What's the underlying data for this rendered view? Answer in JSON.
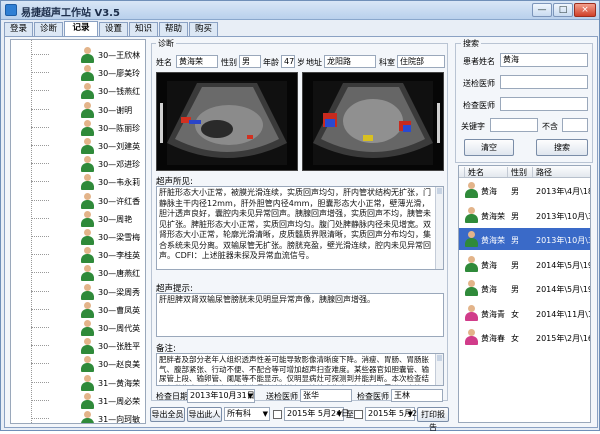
{
  "window": {
    "title": "易捷超声工作站 V3.5",
    "min": "—",
    "max": "□",
    "close": "×"
  },
  "tabs": [
    "登录",
    "诊断",
    "记录",
    "设置",
    "知识",
    "帮助",
    "购买"
  ],
  "patients": [
    {
      "label": "30—王欣林",
      "color": "#2f8a3a"
    },
    {
      "label": "30—廖美玲",
      "color": "#2f8a3a"
    },
    {
      "label": "30—钱燕红",
      "color": "#2f8a3a"
    },
    {
      "label": "30—谢明",
      "color": "#2f8a3a"
    },
    {
      "label": "30—陈丽珍",
      "color": "#2f8a3a"
    },
    {
      "label": "30—刘建英",
      "color": "#2f8a3a"
    },
    {
      "label": "30—邓进珍",
      "color": "#2f8a3a"
    },
    {
      "label": "30—韦永莉",
      "color": "#2f8a3a"
    },
    {
      "label": "30—许红香",
      "color": "#2f8a3a"
    },
    {
      "label": "30—周艳",
      "color": "#2f8a3a"
    },
    {
      "label": "30—梁雪梅",
      "color": "#2f8a3a"
    },
    {
      "label": "30—李桂英",
      "color": "#2f8a3a"
    },
    {
      "label": "30—唐燕红",
      "color": "#2f8a3a"
    },
    {
      "label": "30—梁周秀",
      "color": "#2f8a3a"
    },
    {
      "label": "30—曹凤英",
      "color": "#2f8a3a"
    },
    {
      "label": "30—周代英",
      "color": "#2f8a3a"
    },
    {
      "label": "30—张胜平",
      "color": "#2f8a3a"
    },
    {
      "label": "30—赵良美",
      "color": "#2f8a3a"
    },
    {
      "label": "31—黄海荣",
      "color": "#2f8a3a"
    },
    {
      "label": "31—周必荣",
      "color": "#2f8a3a"
    },
    {
      "label": "31—向珂敏",
      "color": "#2f8a3a"
    }
  ],
  "diagnosis": {
    "legend": "诊断",
    "name_label": "姓名",
    "name": "黄海荣",
    "sex_label": "性别",
    "sex": "男",
    "age_label": "年龄",
    "age": "47",
    "age_unit": "岁",
    "address_label": "地址",
    "address": "龙阳路",
    "dept_label": "科室",
    "dept": "住院部",
    "findings_label": "超声所见:",
    "findings": "肝脏形态大小正常，被膜光滑连续，实质回声均匀，肝内管状结构无扩张，门静脉主干内径12mm，肝外胆管内径4mm，胆囊形态大小正常，壁薄光滑，胆汁透声良好，囊腔内未见异常回声。胰腺回声增强，实质回声不均，胰管未见扩张。脾脏形态大小正常，实质回声均匀。腹门处脾静脉内径未见增宽。双肾形态大小正常，轮廓光滑清晰，皮质髓质界限清晰，实质回声分布均匀，集合系统未见分离。双输尿管无扩张。膀胱充盈，壁光滑连续，腔内未见异常回声。CDFI：上述脏器未探及异常血流信号。",
    "impression_label": "超声提示:",
    "impression": "肝胆脾双肾双输尿管膀胱未见明显异常声像，胰腺回声增强。",
    "remarks_label": "备注:",
    "remarks": "肥胖者及部分老年人组织透声性差可能导致影像清晰度下降。消瘦、胃肠、胃肠胀气、腹部紧张、行动不便、不配合等可增加超声扫查难度。某些器官如胆囊管、输尿管上段、输卵管、阑尾等不能显示。仅明显病灶可探测到并能判断。本次检查结果仅供临床医生参考不能作为最终诊断依据，请结合临床，如有疑问需进一步检查。",
    "exam_date_label": "检查日期",
    "exam_date": "2013年10月31日",
    "sender_label": "送检医师",
    "sender": "张华",
    "examiner_label": "检查医师",
    "examiner": "王林"
  },
  "bottom": {
    "export_all": "导出全员",
    "export_one": "导出此人",
    "dept_select": "所有科",
    "date_from": "2015年 5月24日",
    "to_label": "至",
    "date_to": "2015年 5月24日",
    "print": "打印报告"
  },
  "search": {
    "legend": "搜索",
    "name_label": "患者姓名",
    "name_value": "黄海",
    "sender_label": "送检医师",
    "sender_value": "",
    "examiner_label": "检查医师",
    "examiner_value": "",
    "keyword_label": "关键字",
    "keyword_value": "",
    "not_label": "不含",
    "not_value": "",
    "clear": "清空",
    "search": "搜索"
  },
  "results": {
    "headers": [
      "姓名",
      "性别",
      "路径"
    ],
    "rows": [
      {
        "name": "黄海",
        "sex": "男",
        "path": "2013年\\4月\\18",
        "color": "#2f8a3a",
        "selected": false
      },
      {
        "name": "黄海荣",
        "sex": "男",
        "path": "2013年\\10月\\3",
        "color": "#2f8a3a",
        "selected": false
      },
      {
        "name": "黄海荣",
        "sex": "男",
        "path": "2013年\\10月\\3",
        "color": "#2f8a3a",
        "selected": true
      },
      {
        "name": "黄海",
        "sex": "男",
        "path": "2014年\\5月\\19",
        "color": "#2f8a3a",
        "selected": false
      },
      {
        "name": "黄海",
        "sex": "男",
        "path": "2014年\\5月\\19",
        "color": "#2f8a3a",
        "selected": false
      },
      {
        "name": "黄海青",
        "sex": "女",
        "path": "2014年\\11月\\1",
        "color": "#d13c8a",
        "selected": false
      },
      {
        "name": "黄海春",
        "sex": "女",
        "path": "2015年\\2月\\16",
        "color": "#d13c8a",
        "selected": false
      }
    ]
  }
}
